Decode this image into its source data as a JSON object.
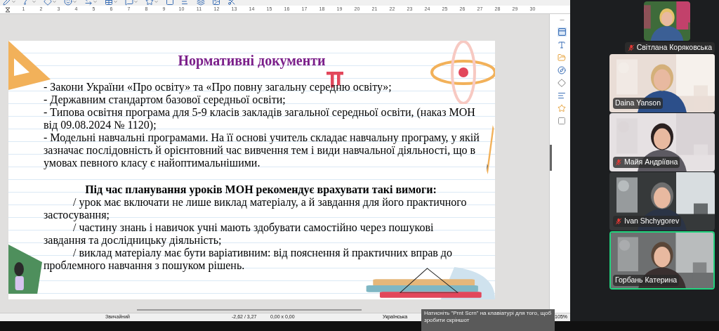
{
  "ruler": {
    "labels": [
      "1",
      "2",
      "3",
      "4",
      "5",
      "6",
      "7",
      "8",
      "9",
      "10",
      "11",
      "12",
      "13",
      "14",
      "15",
      "16",
      "17",
      "18",
      "19",
      "20",
      "21",
      "22",
      "23",
      "24",
      "25",
      "26",
      "27",
      "28",
      "29",
      "30"
    ]
  },
  "slide": {
    "title": "Нормативні документи",
    "documents": [
      "- Закони України «Про освіту» та «Про повну загальну середню освіту»;",
      "- Державним стандартом базової середньої освіти;",
      "- Типова освітня програма для 5-9 класів закладів загальної середньої освіти, (наказ МОН від 09.08.2024 № 1120);",
      "- Модельні навчальні програмами. На її основі учитель складає навчальну програму, у якій зазначає послідовність й орієнтовний час вивчення тем і види навчальної діяльності, що в умовах певного класу є найоптимальнішими."
    ],
    "requirements_heading": "Під час планування уроків МОН рекомендує врахувати такі вимоги:",
    "requirements": [
      "/ урок має включати не лише виклад матеріалу, а й завдання для його практичного застосування;",
      "/ частину знань і навичок учні мають здобувати самостійно через пошукові завдання та дослідницьку діяльність;",
      "/ виклад матеріалу має бути варіативним: від пояснення й практичних вправ до проблемного навчання з пошуком рішень."
    ]
  },
  "status_bar": {
    "style": "Звичайний",
    "position": "-2,62 / 3,27",
    "size": "0,00 x 0,00",
    "language": "Українська",
    "zoom": "105%"
  },
  "notification": {
    "lines": [
      "Натисніть \"Prnt Scrn\" на клавіатурі для того, щоб",
      "зробити скріншот"
    ]
  },
  "participants": [
    {
      "name": "Світлана Коряковська",
      "muted": true,
      "active": false
    },
    {
      "name": "Daina Yanson",
      "muted": false,
      "active": false
    },
    {
      "name": "Майя Андріївна",
      "muted": true,
      "active": false
    },
    {
      "name": "Ivan Shchygorev",
      "muted": true,
      "active": false
    },
    {
      "name": "Горбань Катерина",
      "muted": false,
      "active": true
    }
  ]
}
